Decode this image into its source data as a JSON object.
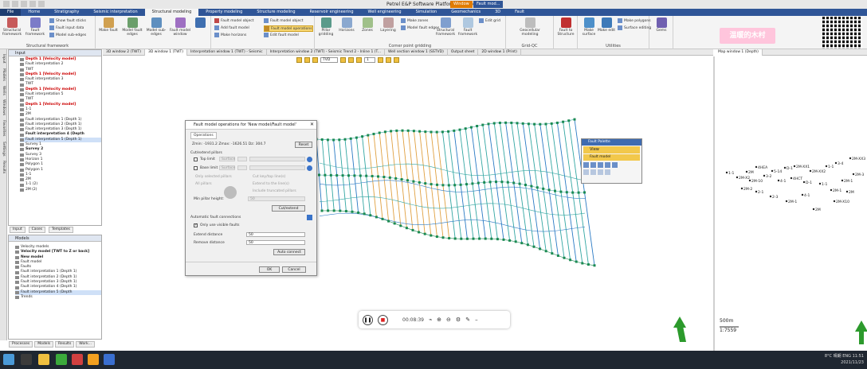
{
  "window_title": "Petrel E&P Software Platform - [Video1]",
  "context_tabs": [
    "Window",
    "Fault mod..."
  ],
  "ribbon_tabs": [
    "File",
    "Home",
    "Stratigraphy",
    "Seismic interpretation",
    "Structural modeling",
    "Property modeling",
    "Structure modeling",
    "Reservoir engineering",
    "Well engineering",
    "Simulation",
    "Geomechanics",
    "3D",
    "Fault"
  ],
  "active_tab": "Structural modeling",
  "ribbon": {
    "groups": [
      {
        "label": "Structural framework",
        "buttons": [
          "Structural framework",
          "Fault framework",
          "Model sub-edges",
          "Model fault edges"
        ]
      },
      {
        "label": "Corner point gridding",
        "buttons": [
          "Model fault edges",
          "Pillar gridding",
          "Horizons",
          "Zones",
          "Layering"
        ]
      },
      {
        "label": "Grid edit",
        "buttons": [
          "Geocellular modeling",
          "Grid-QC",
          "Edit grid"
        ]
      },
      {
        "label": "Utilities",
        "buttons": [
          "Make edit",
          "Fault to Structure",
          "Make surface",
          "Make polygons",
          "Surface editing"
        ]
      },
      {
        "label": "Gems",
        "buttons": [
          "Gems"
        ]
      }
    ],
    "small": [
      "Show fault sticks",
      "Fault input data",
      "Make fault",
      "Fault model object",
      "Fault model operations",
      "Edit fault model",
      "Add fault model",
      "Fault model window",
      "Model sub-edges",
      "Make horizons",
      "Make zones"
    ]
  },
  "watermark_text": "温暖的木村",
  "input_panel": {
    "title": "Input",
    "items": [
      {
        "label": "Depth 1 [Velocity model]",
        "style": "red"
      },
      {
        "label": "Fault interpretation 2",
        "style": ""
      },
      {
        "label": "TWT",
        "style": ""
      },
      {
        "label": "Depth 1 [Velocity model]",
        "style": "red"
      },
      {
        "label": "Fault interpretation 3",
        "style": ""
      },
      {
        "label": "TWT",
        "style": ""
      },
      {
        "label": "Depth 1 [Velocity model]",
        "style": "red"
      },
      {
        "label": "Fault interpretation 5",
        "style": ""
      },
      {
        "label": "TWT",
        "style": ""
      },
      {
        "label": "Depth 1 [Velocity model]",
        "style": "red"
      },
      {
        "label": "1-1",
        "style": ""
      },
      {
        "label": "2M",
        "style": ""
      },
      {
        "label": "Fault interpretation 1 (Depth 1)",
        "style": ""
      },
      {
        "label": "Fault interpretation 2 (Depth 1)",
        "style": ""
      },
      {
        "label": "Fault interpretation 3 (Depth 1)",
        "style": ""
      },
      {
        "label": "Fault interpretation 4 (Depth",
        "style": "bold"
      },
      {
        "label": "Fault interpretation 5 (Depth 1)",
        "style": "sel"
      },
      {
        "label": "Survey 1",
        "style": ""
      },
      {
        "label": "Survey 2",
        "style": "bold"
      },
      {
        "label": "Survey 3",
        "style": ""
      },
      {
        "label": "Horizon 1",
        "style": ""
      },
      {
        "label": "Polygon 1",
        "style": ""
      },
      {
        "label": "Polygon 1",
        "style": ""
      },
      {
        "label": "1-1",
        "style": ""
      },
      {
        "label": "2M",
        "style": ""
      },
      {
        "label": "1-1 (2)",
        "style": ""
      },
      {
        "label": "2M (2)",
        "style": ""
      }
    ],
    "tabs": [
      "Input",
      "Cases",
      "Templates"
    ]
  },
  "models_panel": {
    "title": "Models",
    "items": [
      {
        "label": "Velocity models",
        "style": ""
      },
      {
        "label": "Velocity model [TWT to Z or back]",
        "style": "bold"
      },
      {
        "label": "New model",
        "style": "bold"
      },
      {
        "label": "Fault model",
        "style": ""
      },
      {
        "label": "Faults",
        "style": ""
      },
      {
        "label": "Fault interpretation 1 (Depth 1)",
        "style": ""
      },
      {
        "label": "Fault interpretation 2 (Depth 1)",
        "style": ""
      },
      {
        "label": "Fault interpretation 3 (Depth 1)",
        "style": ""
      },
      {
        "label": "Fault interpretation 4 (Depth 1)",
        "style": ""
      },
      {
        "label": "Fault interpretation 5 (Depth",
        "style": "sel"
      },
      {
        "label": "Trends",
        "style": ""
      }
    ],
    "tabs": [
      "Processes",
      "Models",
      "Results",
      "Work..."
    ]
  },
  "side_tabs": [
    "Input",
    "Models",
    "Wells",
    "Windows",
    "Favorites",
    "Settings",
    "Results"
  ],
  "window_tabs": [
    "3D window 2 (TWT)",
    "3D window 1 (TWT)",
    "Interpretation window 1 (TWT) - Seismic",
    "Interpretation window 2 (TWT) - Seismic Trend 2 - Inline 1 (T...",
    "Well section window 1 (SSTVD)",
    "Output sheet",
    "2D window 1 (Print)"
  ],
  "active_window_tab": "3D window 1 (TWT)",
  "map_window_tab": "Map window 1 (Depth)",
  "view_toolbar": {
    "domain": "TVD",
    "count": "1"
  },
  "dialog": {
    "title": "Fault model operations for 'New model/Fault model'",
    "tab": "Operations",
    "stats": "Zmin: -1931.2   Zmax: -1626.51   Dz: 304.7",
    "reset": "Reset",
    "section_cut": "Cut/extend pillars",
    "top_limit": "Top limit",
    "base_limit": "Base limit",
    "surface": "Surface",
    "only_selected": "Only selected pillars",
    "all_pillars": "All pillars",
    "cut_key_pillars": "Cut key/top line(s)",
    "extend_to_line": "Extend to the line(s)",
    "include_truncated": "Include truncated pillars",
    "min_pillar_height": "Min pillar height:",
    "min_pillar_val": "50",
    "cut_extend_btn": "Cut/extend",
    "section_auto": "Automatic fault connections",
    "only_visible": "Only use visible faults",
    "extend_distance_label": "Extend distance",
    "extend_distance_val": "50",
    "remove_distance_label": "Remove distance",
    "remove_distance_val": "50",
    "auto_connect": "Auto connect",
    "ok": "OK",
    "cancel": "Cancel"
  },
  "fault_palette": {
    "title": "Fault Palette",
    "view": "View",
    "model": "Fault model"
  },
  "well_labels": [
    "1-1",
    "2M",
    "4HEA",
    "5-14",
    "D-1",
    "2M-XX1",
    "2M-XX2",
    "1-1",
    "3-4",
    "2M-XX3",
    "2M-X2",
    "2M-10",
    "3-2",
    "4-1",
    "4HCT",
    "D-1",
    "1-1",
    "2M-1",
    "2M",
    "2M-3",
    "2M-2",
    "2-1",
    "2-3",
    "2M-1",
    "4-1",
    "2M",
    "2M-X10",
    "2M-1"
  ],
  "scale": {
    "distance": "500m",
    "ratio": "1:7559"
  },
  "media": {
    "time": "00:08:39"
  },
  "tray": {
    "lang": "ENG",
    "time": "11:51",
    "date": "2021/11/23",
    "temp": "8°C 晴朗"
  },
  "colors": {
    "ribbon_blue": "#2f5597",
    "fault_cyan": "#32a6a2",
    "fault_green": "#1b8a52",
    "fault_orange": "#e0a040",
    "fault_blue": "#2a7ac4"
  }
}
